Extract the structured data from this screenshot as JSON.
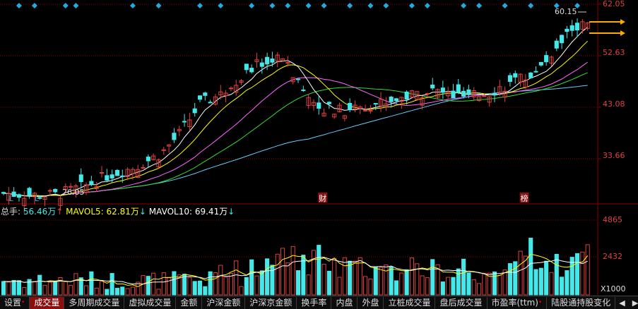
{
  "price_axis": {
    "ticks": [
      "62.05",
      "52.63",
      "43.08",
      "33.66"
    ],
    "unit": "X1000"
  },
  "volume_axis": {
    "ticks": [
      "4865",
      "2432"
    ]
  },
  "annotations": {
    "high_label": "60.15",
    "low_label": "26.05",
    "markers": [
      {
        "text": "L",
        "x_index": 1
      },
      {
        "text": "L",
        "x_index": 6
      },
      {
        "text": "财",
        "x_index": 61
      },
      {
        "text": "榜",
        "x_index": 100
      }
    ]
  },
  "volume_legend": {
    "total_label": "总手: ",
    "total_value": "56.46万",
    "total_arrow": "↑",
    "mavol5_label": "MAVOL5: ",
    "mavol5_value": "62.81万",
    "mavol5_arrow": "↓",
    "mavol10_label": "MAVOL10: ",
    "mavol10_value": "69.41万",
    "mavol10_arrow": "↓"
  },
  "tabs": [
    {
      "label": "设置",
      "dot": true,
      "active": false
    },
    {
      "label": "成交量",
      "active": true
    },
    {
      "label": "多周期成交量"
    },
    {
      "label": "虚拟成交量"
    },
    {
      "label": "金额"
    },
    {
      "label": "沪深金额"
    },
    {
      "label": "沪深京金额"
    },
    {
      "label": "换手率"
    },
    {
      "label": "内盘"
    },
    {
      "label": "外盘"
    },
    {
      "label": "立桩成交量"
    },
    {
      "label": "盘后成交量"
    },
    {
      "label": "市盈率(ttm)",
      "dot": true
    },
    {
      "label": "陆股通持股变化"
    }
  ],
  "nav": {
    "prev": "◀",
    "next": "▶"
  },
  "colors": {
    "up": "#e04040",
    "down": "#44e8e8",
    "grid": "#8b0000",
    "ma5": "#ffffff",
    "ma10": "#ffff00",
    "ma20": "#ff66ff",
    "ma30": "#33dd33",
    "ma60": "#66ccff",
    "marker": "#22aadd",
    "arrow": "#ffaa00"
  },
  "chart_data": {
    "type": "candlestick",
    "price_range": [
      25.0,
      62.05
    ],
    "volume_range": [
      0,
      5200
    ],
    "count": 114,
    "ohlc_generated_by_script": true,
    "moving_averages": [
      "MA5",
      "MA10",
      "MA20",
      "MA30",
      "MA60"
    ],
    "volume_series": [
      "MAVOL5",
      "MAVOL10"
    ]
  }
}
